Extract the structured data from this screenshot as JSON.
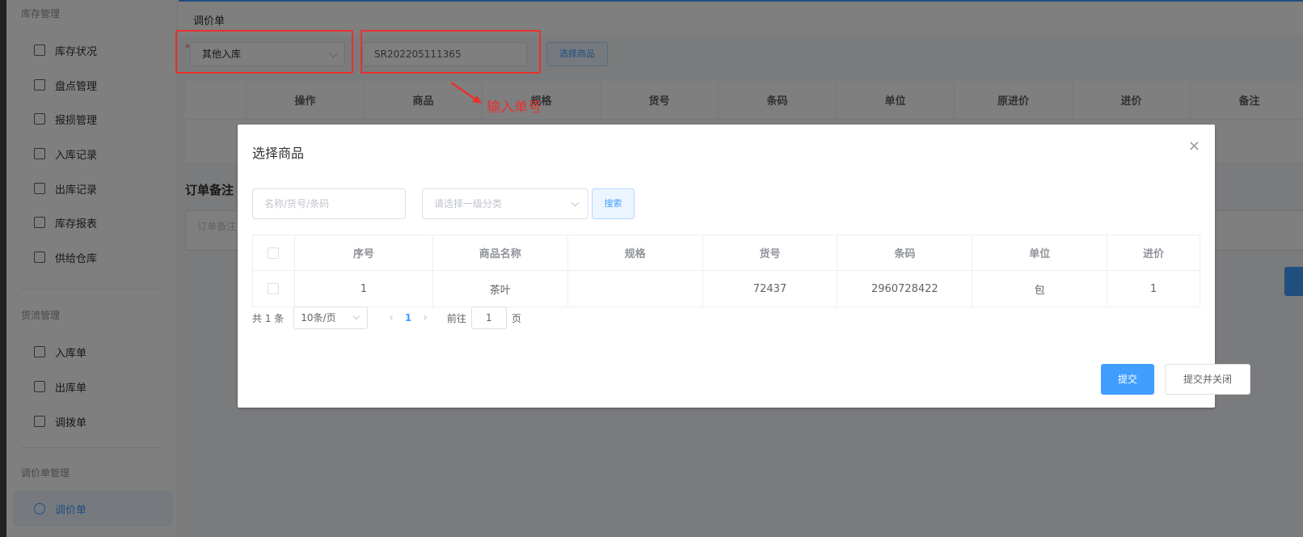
{
  "sidebar": {
    "sections": [
      {
        "title": "库存管理",
        "items": [
          "库存状况",
          "盘点管理",
          "报损管理",
          "入库记录",
          "出库记录",
          "库存报表",
          "供给仓库"
        ]
      },
      {
        "title": "货流管理",
        "items": [
          "入库单",
          "出库单",
          "调拨单"
        ]
      },
      {
        "title": "调价单管理",
        "items": [
          "调价单"
        ]
      }
    ],
    "active_item": "调价单"
  },
  "page": {
    "title": "调价单",
    "warehouse_select": "其他入库",
    "order_number": "SR202205111365",
    "select_goods_button": "选择商品",
    "annotation": "输入单号",
    "table_headers": [
      "操作",
      "商品",
      "规格",
      "货号",
      "条码",
      "单位",
      "原进价",
      "进价",
      "备注"
    ],
    "remark_label": "订单备注",
    "remark_placeholder": "订单备注"
  },
  "dialog": {
    "title": "选择商品",
    "close": "×",
    "search_placeholder": "名称/货号/条码",
    "category_placeholder": "请选择一级分类",
    "search_button": "搜索",
    "table": {
      "headers": [
        "序号",
        "商品名称",
        "规格",
        "货号",
        "条码",
        "单位",
        "进价"
      ],
      "rows": [
        [
          "1",
          "茶叶",
          "",
          "72437",
          "2960728422",
          "包",
          "1"
        ]
      ]
    },
    "pager": {
      "total": "共 1 条",
      "page_size": "10条/页",
      "prev": "‹",
      "current": "1",
      "next": "›",
      "goto_label": "前往",
      "goto_value": "1",
      "page_unit": "页"
    },
    "submit_button": "提交",
    "submit_close_button": "提交并关闭"
  },
  "colors": {
    "primary": "#409eff",
    "annotation": "#e8312f"
  }
}
